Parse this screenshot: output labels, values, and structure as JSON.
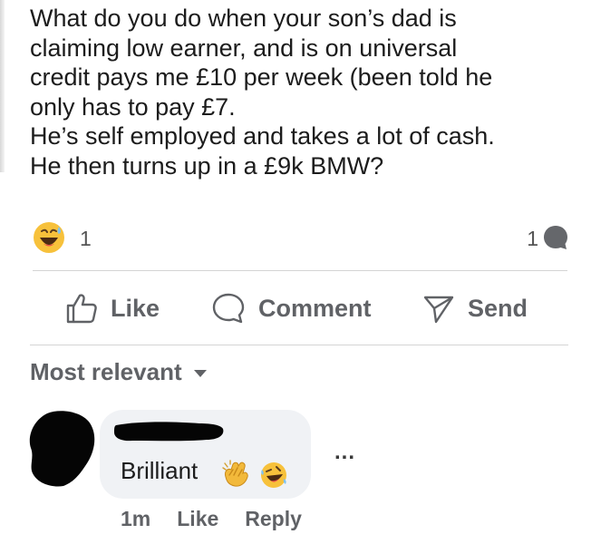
{
  "post": {
    "text": "What do you do when your son’s dad is\nclaiming low earner, and is on universal\ncredit pays me £10 per week (been told he\nonly has to pay £7.\nHe’s self employed and takes a lot of cash.\nHe then turns up in a £9k BMW?"
  },
  "reactions": {
    "emoji_icon": "grinning-sweat-emoji",
    "count": "1",
    "comments_count": "1",
    "comments_icon": "comment-bubble-icon"
  },
  "actions": {
    "like_label": "Like",
    "comment_label": "Comment",
    "send_label": "Send"
  },
  "sort": {
    "label": "Most relevant"
  },
  "comment": {
    "text": "Brilliant",
    "emojis": [
      "clapping-hands-emoji",
      "rolling-laughing-emoji"
    ],
    "time": "1m",
    "like_label": "Like",
    "reply_label": "Reply",
    "more_label": "..."
  },
  "colors": {
    "action_gray": "#606266",
    "bubble_bg": "#f0f2f5",
    "divider": "#d4d4d4"
  }
}
